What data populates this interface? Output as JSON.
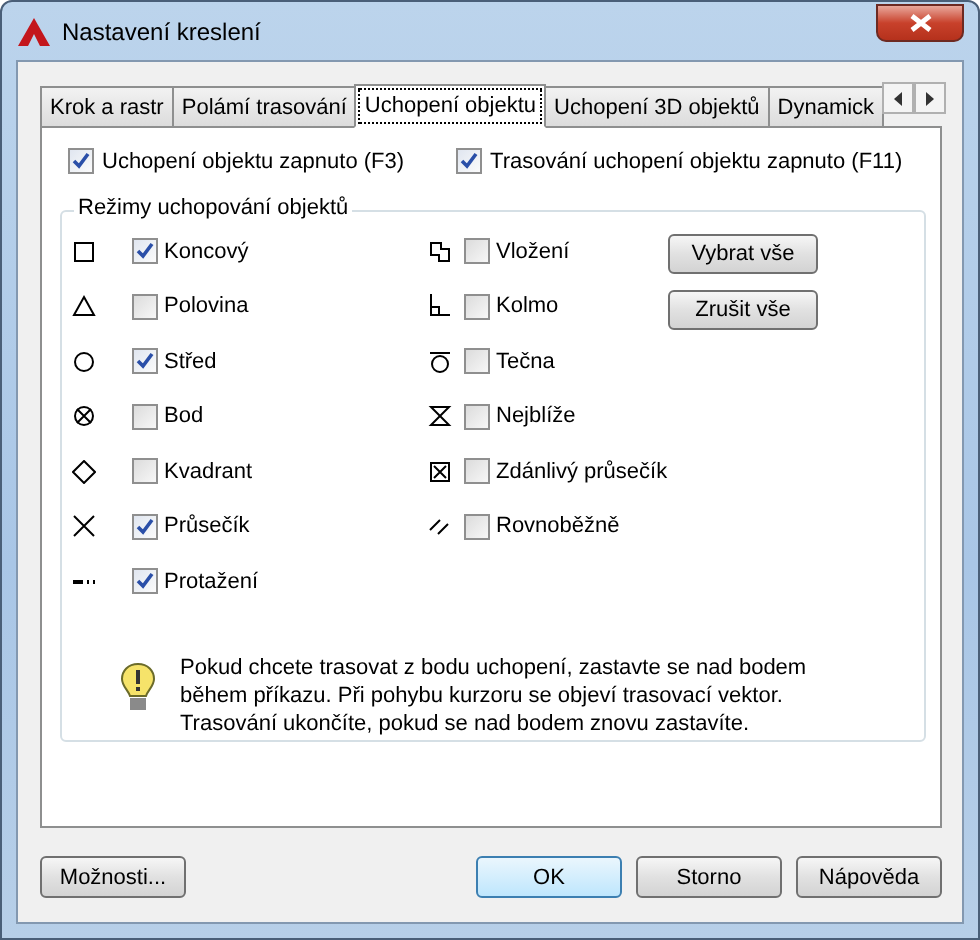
{
  "window": {
    "title": "Nastavení kreslení"
  },
  "tabs": [
    {
      "label": "Krok a rastr",
      "selected": false
    },
    {
      "label": "Polámí trasování",
      "selected": false
    },
    {
      "label": "Uchopení objektu",
      "selected": true
    },
    {
      "label": "Uchopení 3D objektů",
      "selected": false
    },
    {
      "label": "Dynamick",
      "selected": false
    }
  ],
  "toggles": [
    {
      "label": "Uchopení objektu zapnuto (F3)",
      "checked": true
    },
    {
      "label": "Trasování uchopení objektu zapnuto (F11)",
      "checked": true
    }
  ],
  "group": {
    "title": "Režimy uchopování objektů",
    "modes_left": [
      {
        "kind": "endpoint",
        "label": "Koncový",
        "checked": true
      },
      {
        "kind": "midpoint",
        "label": "Polovina",
        "checked": false
      },
      {
        "kind": "center",
        "label": "Střed",
        "checked": true
      },
      {
        "kind": "node",
        "label": "Bod",
        "checked": false
      },
      {
        "kind": "quadrant",
        "label": "Kvadrant",
        "checked": false
      },
      {
        "kind": "intersection",
        "label": "Průsečík",
        "checked": true
      },
      {
        "kind": "extension",
        "label": "Protažení",
        "checked": true
      }
    ],
    "modes_right": [
      {
        "kind": "insertion",
        "label": "Vložení",
        "checked": false
      },
      {
        "kind": "perpendicular",
        "label": "Kolmo",
        "checked": false
      },
      {
        "kind": "tangent",
        "label": "Tečna",
        "checked": false
      },
      {
        "kind": "nearest",
        "label": "Nejblíže",
        "checked": false
      },
      {
        "kind": "apparent",
        "label": "Zdánlivý průsečík",
        "checked": false
      },
      {
        "kind": "parallel",
        "label": "Rovnoběžně",
        "checked": false
      }
    ],
    "buttons": [
      "Vybrat vše",
      "Zrušit vše"
    ],
    "info": "Pokud chcete trasovat z bodu uchopení, zastavte se nad bodem během příkazu. Při pohybu kurzoru se objeví trasovací vektor. Trasování ukončíte, pokud se nad bodem znovu zastavíte."
  },
  "footer": {
    "options": "Možnosti...",
    "buttons": [
      "OK",
      "Storno",
      "Nápověda"
    ]
  }
}
